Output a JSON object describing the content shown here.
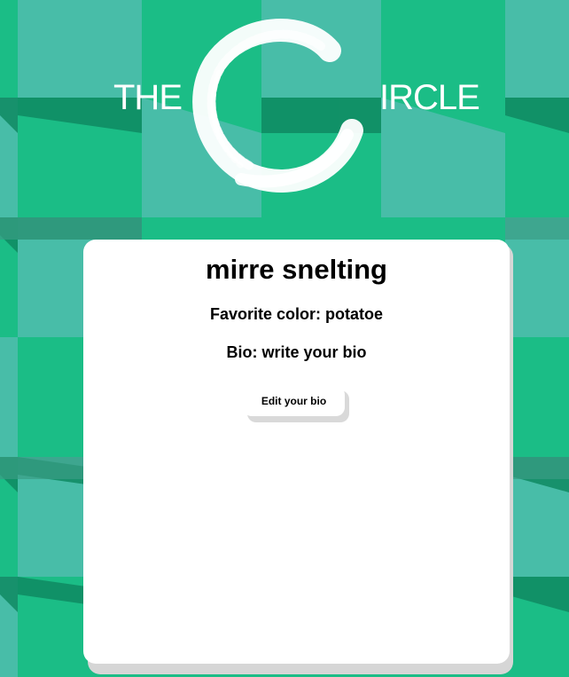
{
  "logo": {
    "text_left": "THE",
    "text_right": "IRCLE"
  },
  "profile": {
    "name": "mirre snelting",
    "favorite_color_label": "Favorite color: potatoe",
    "bio_label": "Bio: write your bio",
    "edit_button_label": "Edit your bio"
  },
  "colors": {
    "background_green": "#1bbd86",
    "tile_light": "#48bda8",
    "tile_dark": "#0f8a62",
    "card": "#ffffff"
  }
}
